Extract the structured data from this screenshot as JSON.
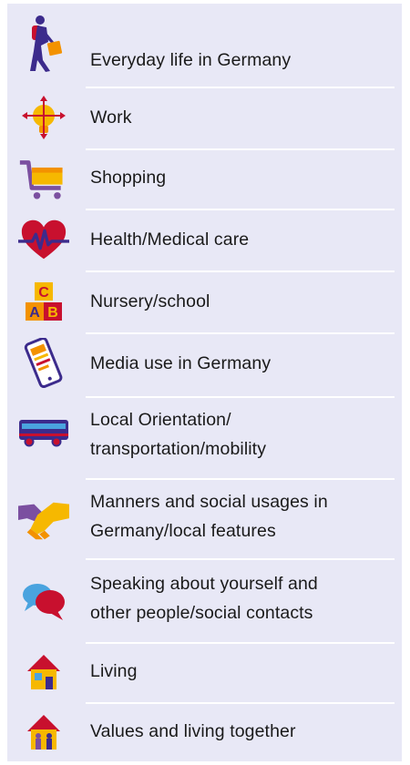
{
  "colors": {
    "panel_background": "#e8e8f6",
    "divider": "#ffffff",
    "text": "#1a1a1a"
  },
  "topics": [
    {
      "label": "Everyday life in Germany",
      "icon": "walking-person-with-bag-icon"
    },
    {
      "label": "Work",
      "icon": "lightbulb-arrows-icon"
    },
    {
      "label": "Shopping",
      "icon": "shopping-cart-icon"
    },
    {
      "label": "Health/Medical care",
      "icon": "heart-pulse-icon"
    },
    {
      "label": "Nursery/school",
      "icon": "abc-blocks-icon"
    },
    {
      "label": "Media use in Germany",
      "icon": "smartphone-icon"
    },
    {
      "label": "Local Orientation/",
      "label_line2": "transportation/mobility",
      "icon": "bus-icon"
    },
    {
      "label": "Manners and social usages in",
      "label_line2": "Germany/local features",
      "icon": "handshake-icon"
    },
    {
      "label": "Speaking about yourself and",
      "label_line2": "other people/social contacts",
      "icon": "speech-bubbles-icon"
    },
    {
      "label": "Living",
      "icon": "house-icon"
    },
    {
      "label": "Values and living together",
      "icon": "house-family-icon"
    }
  ]
}
